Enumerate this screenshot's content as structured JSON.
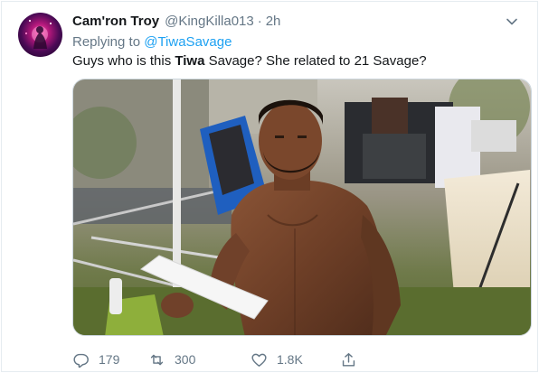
{
  "author": {
    "display_name": "Cam'ron Troy",
    "handle": "@KingKilla013",
    "separator": "·",
    "timestamp": "2h"
  },
  "reply": {
    "prefix": "Replying to",
    "mention": "@TiwaSavage"
  },
  "tweet": {
    "text_before": "Guys who is this ",
    "text_bold": "Tiwa",
    "text_after": " Savage? She related to 21 Savage?"
  },
  "media": {
    "icon": "photo"
  },
  "actions": {
    "reply_count": "179",
    "retweet_count": "300",
    "like_count": "1.8K"
  },
  "colors": {
    "link": "#1da1f2",
    "secondary_text": "#657786",
    "primary_text": "#14171a"
  }
}
